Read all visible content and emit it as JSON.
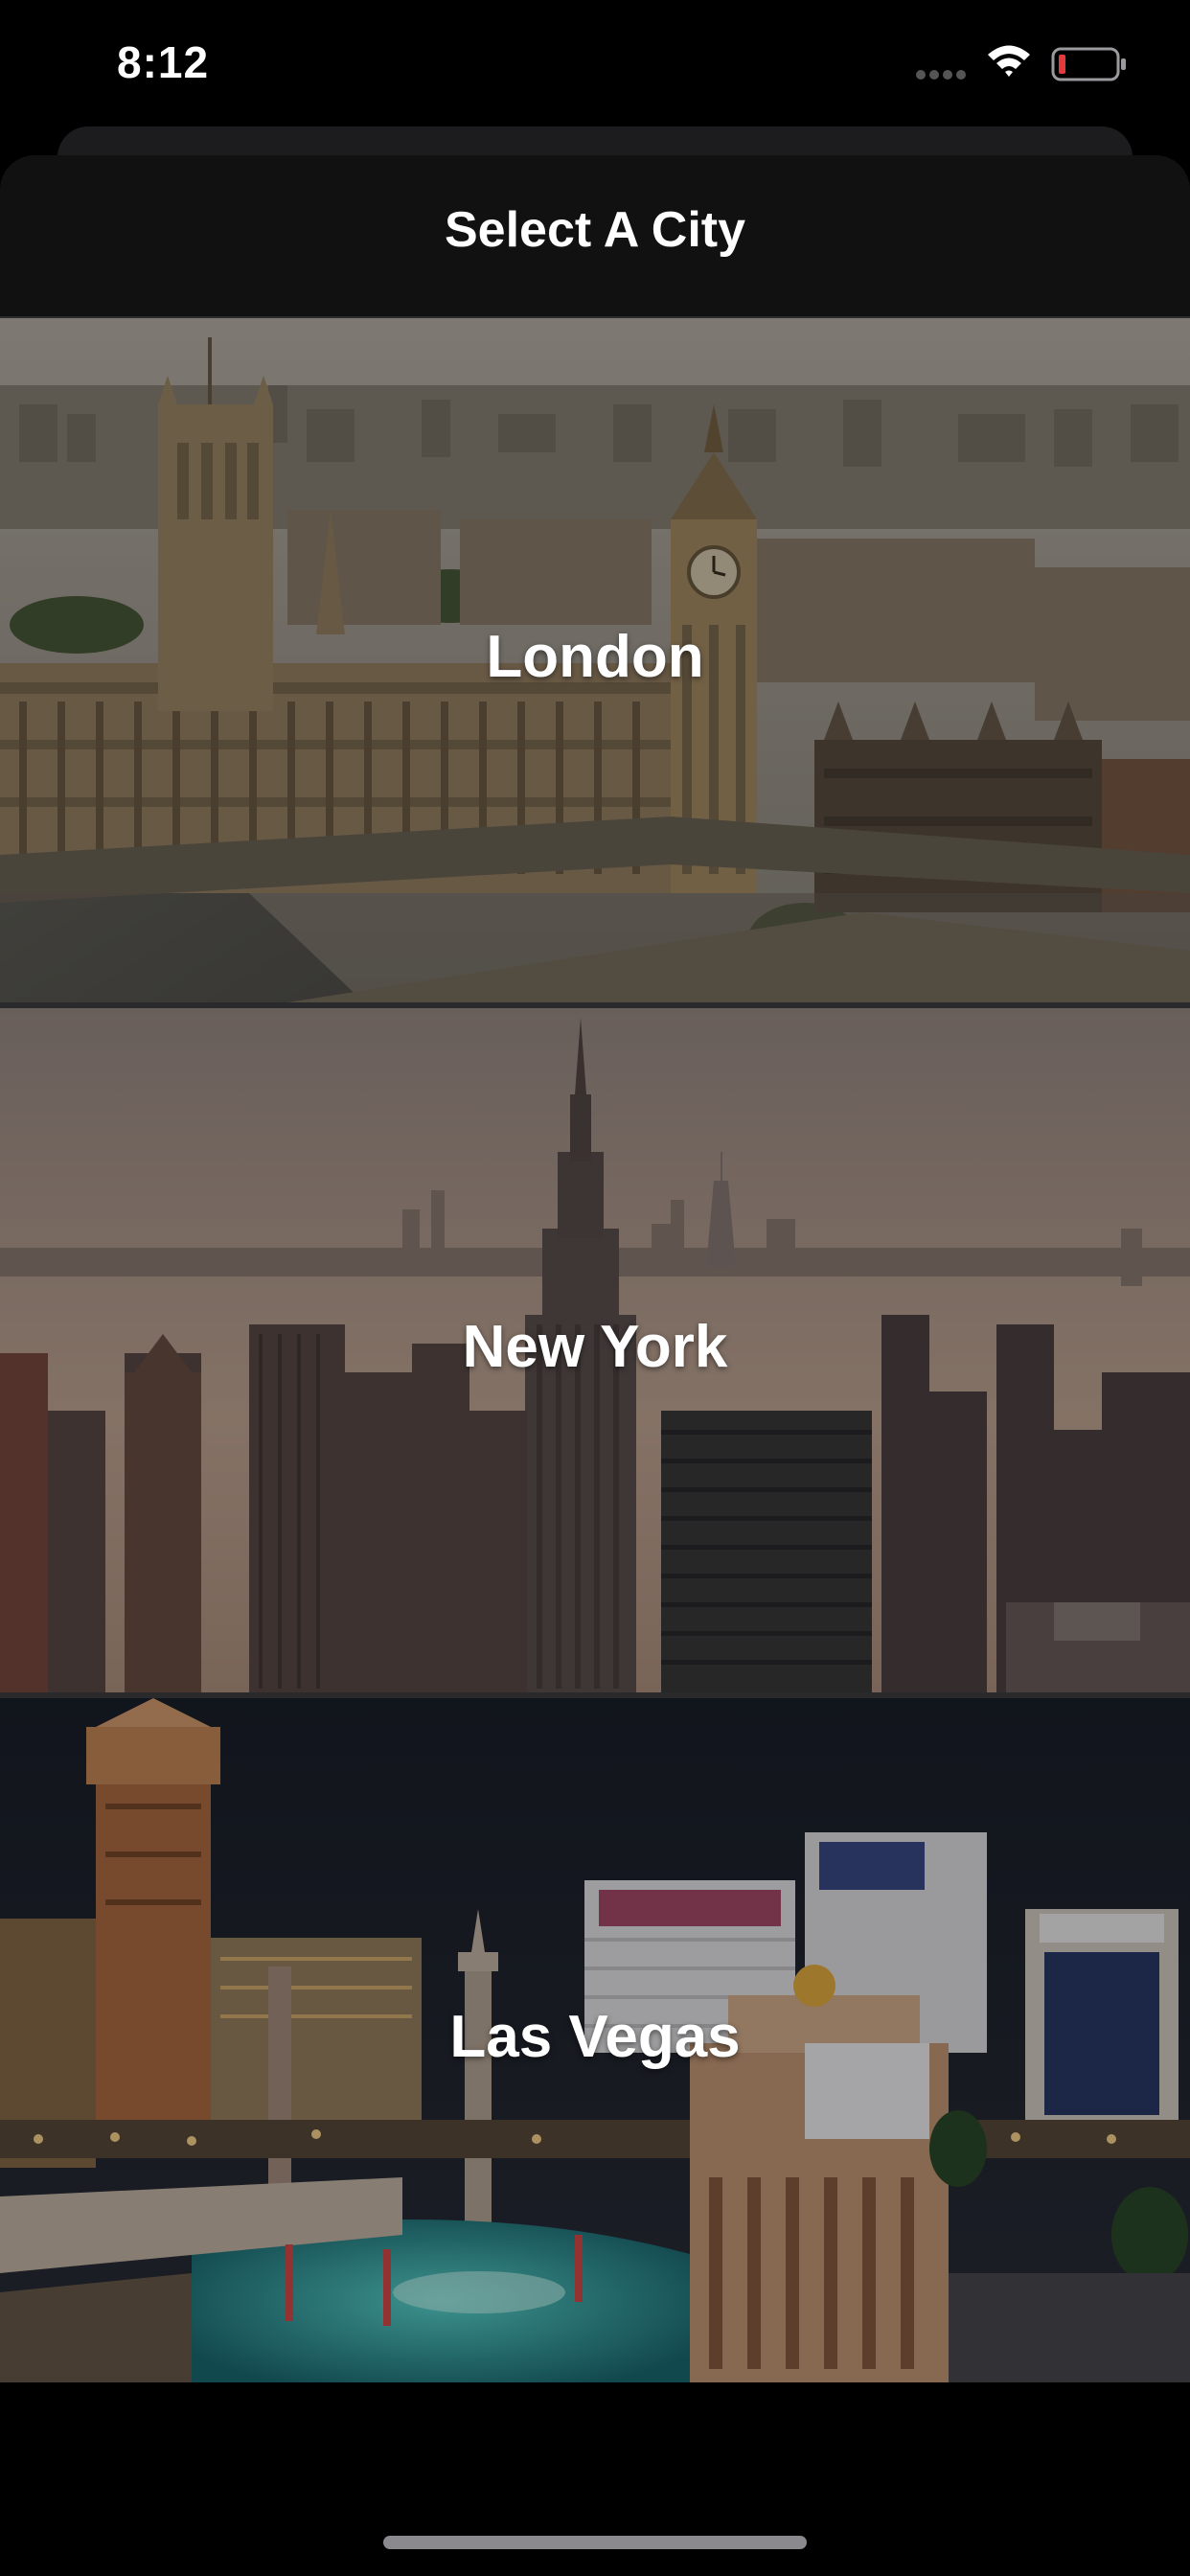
{
  "status_bar": {
    "time": "8:12",
    "icons": [
      "cellular-signal-icon",
      "wifi-icon",
      "battery-low-icon"
    ],
    "battery_color": "#e5393b"
  },
  "header": {
    "title": "Select A City"
  },
  "cities": [
    {
      "name": "London",
      "icon": "big-ben-skyline-photo"
    },
    {
      "name": "New York",
      "icon": "empire-state-skyline-photo"
    },
    {
      "name": "Las Vegas",
      "icon": "las-vegas-strip-night-photo"
    }
  ],
  "colors": {
    "background": "#000000",
    "header": "#111112",
    "text": "#ffffff"
  }
}
